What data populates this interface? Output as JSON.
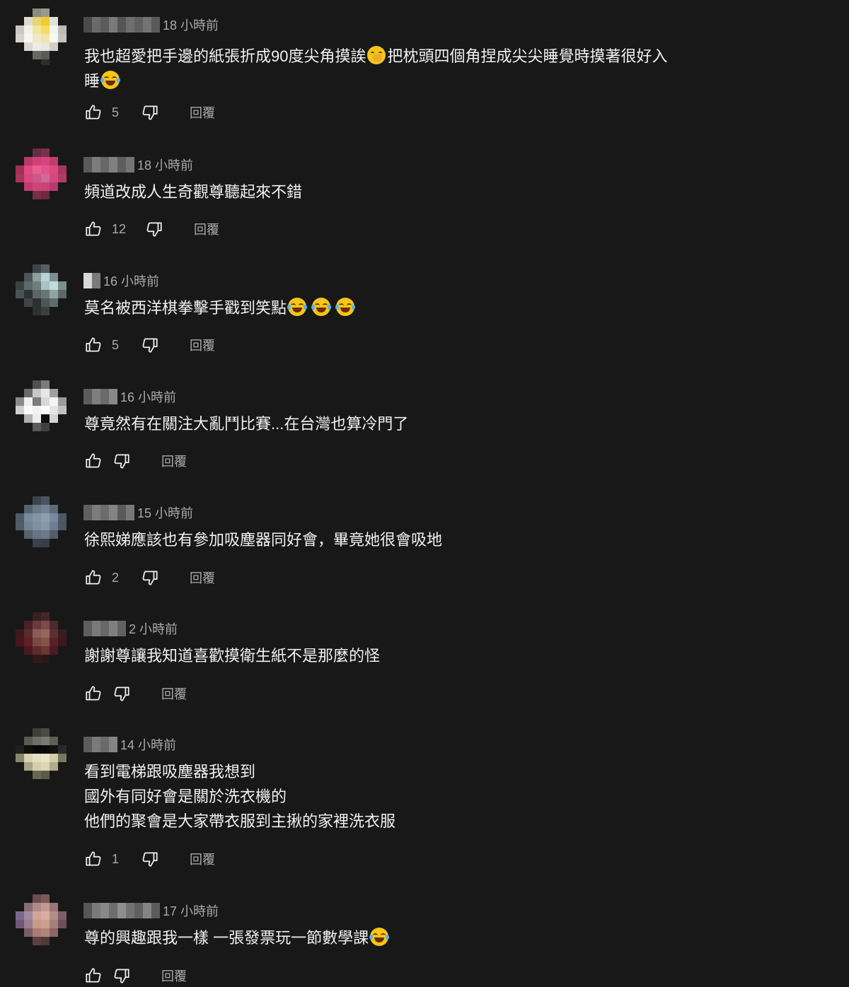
{
  "reply_label": "回覆",
  "icons": {
    "like": "thumbs-up-icon",
    "dislike": "thumbs-down-icon"
  },
  "colors": {
    "background": "#181818",
    "text": "#f1f1f1",
    "secondary_text": "#aaaaaa"
  },
  "comments": [
    {
      "timestamp": "18 小時前",
      "text": "我也超愛把手邊的紙張折成90度尖角摸誒🫢把枕頭四個角捏成尖尖睡覺時摸著很好入睡😂",
      "likes": "5"
    },
    {
      "timestamp": "18 小時前",
      "text": "頻道改成人生奇觀尊聽起來不錯",
      "likes": "12"
    },
    {
      "timestamp": "16 小時前",
      "text": "莫名被西洋棋拳擊手戳到笑點😂😂😂",
      "likes": "5"
    },
    {
      "timestamp": "16 小時前",
      "text": "尊竟然有在關注大亂鬥比賽...在台灣也算冷門了",
      "likes": ""
    },
    {
      "timestamp": "15 小時前",
      "text": "徐熙娣應該也有參加吸塵器同好會，畢竟她很會吸地",
      "likes": "2"
    },
    {
      "timestamp": "2 小時前",
      "text": "謝謝尊讓我知道喜歡摸衛生紙不是那麼的怪",
      "likes": ""
    },
    {
      "timestamp": "14 小時前",
      "text": "看到電梯跟吸塵器我想到\n國外有同好會是關於洗衣機的\n他們的聚會是大家帶衣服到主揪的家裡洗衣服",
      "likes": "1"
    },
    {
      "timestamp": "17 小時前",
      "text": "尊的興趣跟我一樣 一張發票玩一節數學課😂",
      "likes": ""
    }
  ]
}
